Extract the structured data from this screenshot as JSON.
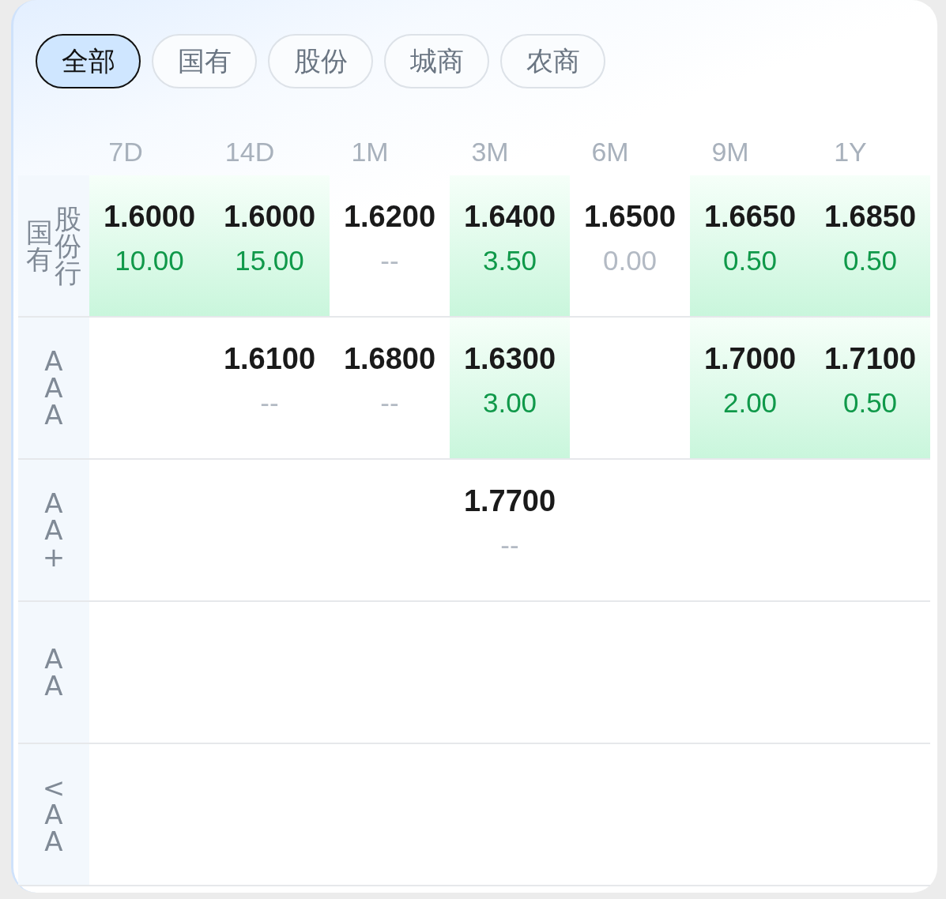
{
  "tabs": [
    {
      "label": "全部",
      "selected": true
    },
    {
      "label": "国有",
      "selected": false
    },
    {
      "label": "股份",
      "selected": false
    },
    {
      "label": "城商",
      "selected": false
    },
    {
      "label": "农商",
      "selected": false
    }
  ],
  "columns": [
    "7D",
    "14D",
    "1M",
    "3M",
    "6M",
    "9M",
    "1Y"
  ],
  "rows": [
    {
      "label_lines": [
        "国有",
        "股份行"
      ],
      "cells": [
        {
          "rate": "1.6000",
          "change": "10.00",
          "highlight": true
        },
        {
          "rate": "1.6000",
          "change": "15.00",
          "highlight": true
        },
        {
          "rate": "1.6200",
          "change": "--",
          "highlight": false
        },
        {
          "rate": "1.6400",
          "change": "3.50",
          "highlight": true
        },
        {
          "rate": "1.6500",
          "change": "0.00",
          "highlight": false
        },
        {
          "rate": "1.6650",
          "change": "0.50",
          "highlight": true
        },
        {
          "rate": "1.6850",
          "change": "0.50",
          "highlight": true
        }
      ]
    },
    {
      "label_lines": [
        "AAA"
      ],
      "cells": [
        null,
        {
          "rate": "1.6100",
          "change": "--",
          "highlight": false
        },
        {
          "rate": "1.6800",
          "change": "--",
          "highlight": false
        },
        {
          "rate": "1.6300",
          "change": "3.00",
          "highlight": true
        },
        null,
        {
          "rate": "1.7000",
          "change": "2.00",
          "highlight": true
        },
        {
          "rate": "1.7100",
          "change": "0.50",
          "highlight": true
        }
      ]
    },
    {
      "label_lines": [
        "AA+"
      ],
      "cells": [
        null,
        null,
        null,
        {
          "rate": "1.7700",
          "change": "--",
          "highlight": false
        },
        null,
        null,
        null
      ]
    },
    {
      "label_lines": [
        "AA"
      ],
      "cells": [
        null,
        null,
        null,
        null,
        null,
        null,
        null
      ]
    },
    {
      "label_lines": [
        "<AA"
      ],
      "cells": [
        null,
        null,
        null,
        null,
        null,
        null,
        null
      ]
    }
  ]
}
